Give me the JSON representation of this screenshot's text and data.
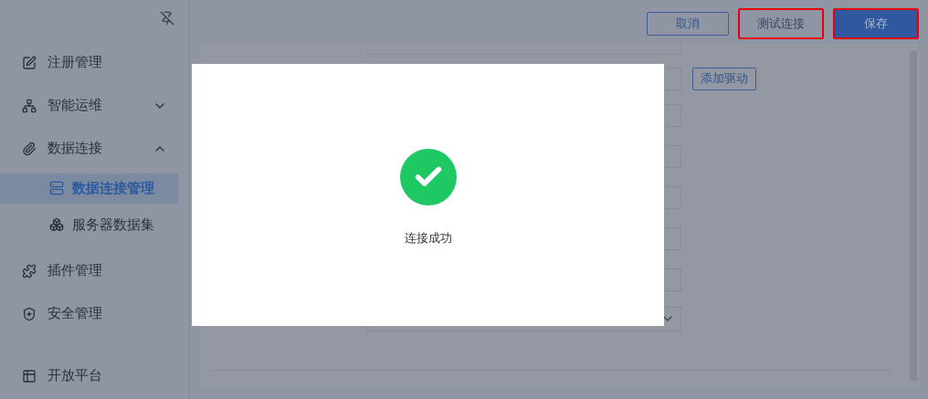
{
  "sidebar": {
    "items": [
      {
        "label": "注册管理",
        "selected": false
      },
      {
        "label": "智能运维",
        "selected": false,
        "expanded": false
      },
      {
        "label": "数据连接",
        "selected": false,
        "expanded": true,
        "children": [
          {
            "label": "数据连接管理",
            "selected": true
          },
          {
            "label": "服务器数据集",
            "selected": false
          }
        ]
      },
      {
        "label": "插件管理",
        "selected": false
      },
      {
        "label": "安全管理",
        "selected": false
      },
      {
        "label": "开放平台",
        "selected": false
      }
    ]
  },
  "toolbar": {
    "buttons": [
      {
        "label": "取消",
        "kind": "outline",
        "highlighted": false
      },
      {
        "label": "测试连接",
        "kind": "default",
        "highlighted": true
      },
      {
        "label": "保存",
        "kind": "primary",
        "highlighted": true
      }
    ]
  },
  "form": {
    "add_driver_button": "添加驱动"
  },
  "dialog": {
    "message": "连接成功"
  }
}
